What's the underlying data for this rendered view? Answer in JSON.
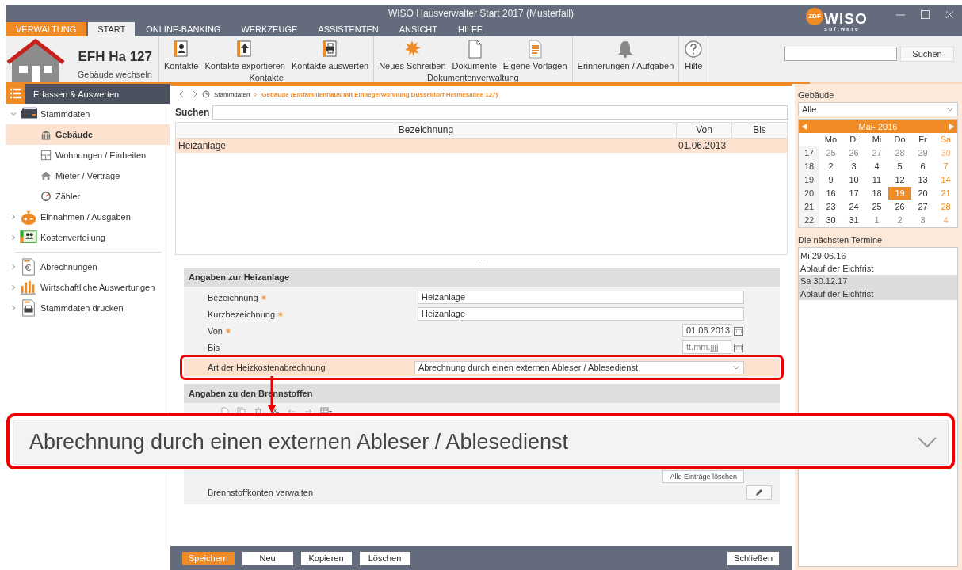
{
  "window": {
    "title": "WISO Hausverwalter Start 2017 (Musterfall)"
  },
  "logo": {
    "mark": "ZDF",
    "name": "WISO",
    "tagline": "software"
  },
  "menu_tabs": [
    {
      "label": "VERWALTUNG",
      "kind": "app",
      "selected": false
    },
    {
      "label": "START",
      "kind": "tab",
      "selected": true
    },
    {
      "label": "ONLINE-BANKING",
      "kind": "tab",
      "selected": false
    },
    {
      "label": "WERKZEUGE",
      "kind": "tab",
      "selected": false
    },
    {
      "label": "ASSISTENTEN",
      "kind": "tab",
      "selected": false
    },
    {
      "label": "ANSICHT",
      "kind": "tab",
      "selected": false
    },
    {
      "label": "HILFE",
      "kind": "tab",
      "selected": false
    }
  ],
  "ribbon": {
    "building": {
      "name": "EFH Ha 127",
      "action": "Gebäude wechseln"
    },
    "groups": [
      {
        "label": "Kontakte",
        "items": [
          {
            "label": "Kontakte",
            "kind": "contact"
          },
          {
            "label": "Kontakte exportieren",
            "kind": "export"
          },
          {
            "label": "Kontakte auswerten",
            "kind": "print"
          }
        ]
      },
      {
        "label": "Dokumentenverwaltung",
        "items": [
          {
            "label": "Neues Schreiben",
            "kind": "new"
          },
          {
            "label": "Dokumente",
            "kind": "document"
          },
          {
            "label": "Eigene Vorlagen",
            "kind": "template"
          }
        ]
      },
      {
        "items": [
          {
            "label": "Erinnerungen / Aufgaben",
            "kind": "bell"
          }
        ]
      },
      {
        "items": [
          {
            "label": "Hilfe",
            "kind": "help"
          }
        ]
      }
    ],
    "search": {
      "button": "Suchen"
    }
  },
  "sidebar": {
    "header": "Erfassen & Auswerten",
    "sections": [
      {
        "items": [
          {
            "label": "Stammdaten",
            "kind": "stammdaten",
            "expanded": true,
            "selected": false,
            "children": [
              {
                "label": "Gebäude",
                "kind": "building",
                "selected": true
              },
              {
                "label": "Wohnungen / Einheiten",
                "kind": "units",
                "selected": false
              },
              {
                "label": "Mieter / Verträge",
                "kind": "tenant",
                "selected": false
              },
              {
                "label": "Zähler",
                "kind": "meter",
                "selected": false
              }
            ]
          },
          {
            "label": "Einnahmen / Ausgaben",
            "kind": "money",
            "expanded": false,
            "selected": false
          },
          {
            "label": "Kostenverteilung",
            "kind": "distribution",
            "expanded": false,
            "selected": false
          }
        ]
      },
      {
        "items": [
          {
            "label": "Abrechnungen",
            "kind": "invoice",
            "expanded": false,
            "selected": false
          },
          {
            "label": "Wirtschaftliche Auswertungen",
            "kind": "chart",
            "expanded": false,
            "selected": false
          },
          {
            "label": "Stammdaten drucken",
            "kind": "printer",
            "expanded": false,
            "selected": false
          }
        ]
      }
    ]
  },
  "content": {
    "breadcrumb": [
      "Stammdaten",
      "Gebäude (Einfamilienhaus mit Einliegerwohnung Düsseldorf Hermesallee 127)"
    ],
    "search": {
      "label": "Suchen"
    },
    "table": {
      "columns": [
        "Bezeichnung",
        "Von",
        "Bis"
      ],
      "rows": [
        {
          "cells": [
            "Heizanlage",
            "01.06.2013"
          ],
          "selected": true
        }
      ]
    },
    "heating": {
      "title": "Angaben zur Heizanlage",
      "fields": [
        {
          "label": "Bezeichnung",
          "required": true,
          "kind": "text",
          "value": "Heizanlage",
          "highlighted": false
        },
        {
          "label": "Kurzbezeichnung",
          "required": true,
          "kind": "text",
          "value": "Heizanlage",
          "highlighted": false
        },
        {
          "label": "Von",
          "required": true,
          "kind": "date",
          "value": "01.06.2013",
          "highlighted": false
        },
        {
          "label": "Bis",
          "required": false,
          "kind": "date",
          "placeholder": "tt.mm.jjjj",
          "highlighted": false
        },
        {
          "label": "Art der Heizkostenabrechnung",
          "required": false,
          "kind": "select",
          "value": "Abrechnung durch einen externen Ableser / Ablesedienst",
          "highlighted": true
        }
      ]
    },
    "fuels": {
      "title": "Angaben zu den Brennstoffen",
      "clear_button": "Alle Einträge löschen",
      "rows": [
        {
          "label": "Brennstoffkonten verwalten"
        }
      ]
    },
    "footer_buttons": [
      {
        "label": "Speichern",
        "kind": "primary"
      },
      {
        "label": "Neu",
        "kind": "secondary"
      },
      {
        "label": "Kopieren",
        "kind": "secondary"
      },
      {
        "label": "Löschen",
        "kind": "secondary"
      },
      {
        "label": "Schließen",
        "kind": "close"
      }
    ]
  },
  "callout": {
    "text": "Abrechnung durch einen externen Ableser / Ablesedienst"
  },
  "right_panel": {
    "building_label": "Gebäude",
    "building_select": "Alle",
    "calendar": {
      "month": "Mai- 2016",
      "weekdays": [
        "Mo",
        "Di",
        "Mi",
        "Do",
        "Fr",
        "Sa"
      ],
      "weeks": [
        {
          "week": "17",
          "days": [
            {
              "day": "25",
              "other_month": true,
              "selected": false
            },
            {
              "day": "26",
              "other_month": true,
              "selected": false
            },
            {
              "day": "27",
              "other_month": true,
              "selected": false
            },
            {
              "day": "28",
              "other_month": true,
              "selected": false
            },
            {
              "day": "29",
              "other_month": true,
              "selected": false
            },
            {
              "day": "30",
              "other_month": true,
              "selected": false
            }
          ]
        },
        {
          "week": "18",
          "days": [
            {
              "day": "2",
              "other_month": false,
              "selected": false
            },
            {
              "day": "3",
              "other_month": false,
              "selected": false
            },
            {
              "day": "4",
              "other_month": false,
              "selected": false
            },
            {
              "day": "5",
              "other_month": false,
              "selected": false
            },
            {
              "day": "6",
              "other_month": false,
              "selected": false
            },
            {
              "day": "7",
              "other_month": false,
              "selected": false
            }
          ]
        },
        {
          "week": "19",
          "days": [
            {
              "day": "9",
              "other_month": false,
              "selected": false
            },
            {
              "day": "10",
              "other_month": false,
              "selected": false
            },
            {
              "day": "11",
              "other_month": false,
              "selected": false
            },
            {
              "day": "12",
              "other_month": false,
              "selected": false
            },
            {
              "day": "13",
              "other_month": false,
              "selected": false
            },
            {
              "day": "14",
              "other_month": false,
              "selected": false
            }
          ]
        },
        {
          "week": "20",
          "days": [
            {
              "day": "16",
              "other_month": false,
              "selected": false
            },
            {
              "day": "17",
              "other_month": false,
              "selected": false
            },
            {
              "day": "18",
              "other_month": false,
              "selected": false
            },
            {
              "day": "19",
              "other_month": false,
              "selected": true
            },
            {
              "day": "20",
              "other_month": false,
              "selected": false
            },
            {
              "day": "21",
              "other_month": false,
              "selected": false
            }
          ]
        },
        {
          "week": "21",
          "days": [
            {
              "day": "23",
              "other_month": false,
              "selected": false
            },
            {
              "day": "24",
              "other_month": false,
              "selected": false
            },
            {
              "day": "25",
              "other_month": false,
              "selected": false
            },
            {
              "day": "26",
              "other_month": false,
              "selected": false
            },
            {
              "day": "27",
              "other_month": false,
              "selected": false
            },
            {
              "day": "28",
              "other_month": false,
              "selected": false
            }
          ]
        },
        {
          "week": "22",
          "days": [
            {
              "day": "30",
              "other_month": false,
              "selected": false
            },
            {
              "day": "31",
              "other_month": false,
              "selected": false
            },
            {
              "day": "1",
              "other_month": true,
              "selected": false
            },
            {
              "day": "2",
              "other_month": true,
              "selected": false
            },
            {
              "day": "3",
              "other_month": true,
              "selected": false
            },
            {
              "day": "4",
              "other_month": true,
              "selected": false
            }
          ]
        }
      ]
    },
    "appointments_title": "Die nächsten Termine",
    "appointments": [
      {
        "date": "Mi 29.06.16",
        "text": "Ablauf der Eichfrist",
        "selected": false
      },
      {
        "date": "Sa 30.12.17",
        "text": "Ablauf der Eichfrist",
        "selected": true
      }
    ]
  }
}
